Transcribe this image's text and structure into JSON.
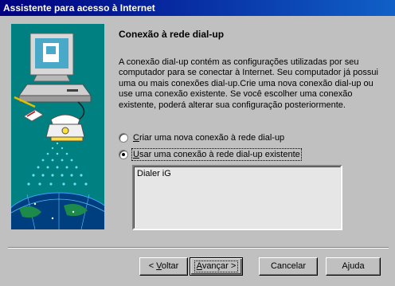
{
  "window": {
    "title": "Assistente para acesso à Internet"
  },
  "main": {
    "heading": "Conexão à rede dial-up",
    "description": "A conexão dial-up contém as configurações utilizadas por seu computador para se conectar à Internet. Seu computador já possui uma ou mais conexões dial-up.Crie uma nova conexão dial-up ou use uma conexão existente. Se você escolher uma conexão existente, poderá alterar sua configuração posteriormente.",
    "options": [
      {
        "prefix": "",
        "accel": "C",
        "rest": "riar uma nova conexão à rede dial-up",
        "selected": false
      },
      {
        "prefix": "",
        "accel": "U",
        "rest": "sar uma conexão à rede dial-up existente",
        "selected": true
      }
    ],
    "connections": [
      "Dialer iG"
    ]
  },
  "buttons": {
    "back": {
      "prefix": "< ",
      "accel": "V",
      "rest": "oltar"
    },
    "next": {
      "prefix": "",
      "accel": "A",
      "rest": "vançar >"
    },
    "cancel": "Cancelar",
    "help": "Ajuda"
  },
  "colors": {
    "titlebar_start": "#000080",
    "titlebar_end": "#1060c8",
    "illustration_bg": "#008080",
    "face": "#c0c0c0"
  }
}
